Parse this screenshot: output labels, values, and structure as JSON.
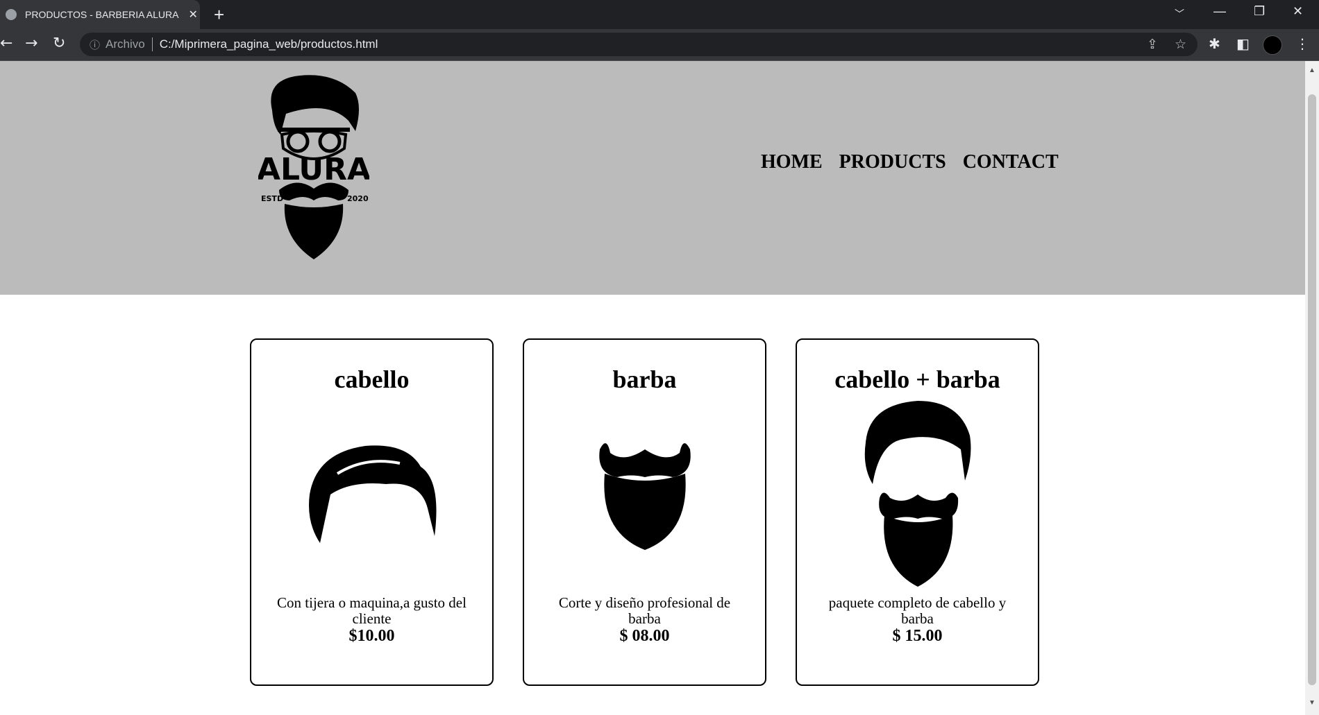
{
  "browser": {
    "tab_title": "PRODUCTOS - BARBERIA ALURA",
    "address_prefix": "Archivo",
    "url": "C:/Miprimera_pagina_web/productos.html"
  },
  "header": {
    "logo_text": "ALURA ESTD 2020",
    "nav": [
      {
        "label": "HOME"
      },
      {
        "label": "PRODUCTS"
      },
      {
        "label": "CONTACT"
      }
    ],
    "background": "#bbbbbb"
  },
  "products": [
    {
      "title": "cabello",
      "description": "Con tijera o maquina,a gusto del cliente",
      "price": "$10.00",
      "icon": "hair-icon"
    },
    {
      "title": "barba",
      "description": "Corte y diseño profesional de barba",
      "price": "$ 08.00",
      "icon": "beard-icon"
    },
    {
      "title": "cabello + barba",
      "description": "paquete completo de cabello y barba",
      "price": "$ 15.00",
      "icon": "hair-beard-icon"
    }
  ]
}
